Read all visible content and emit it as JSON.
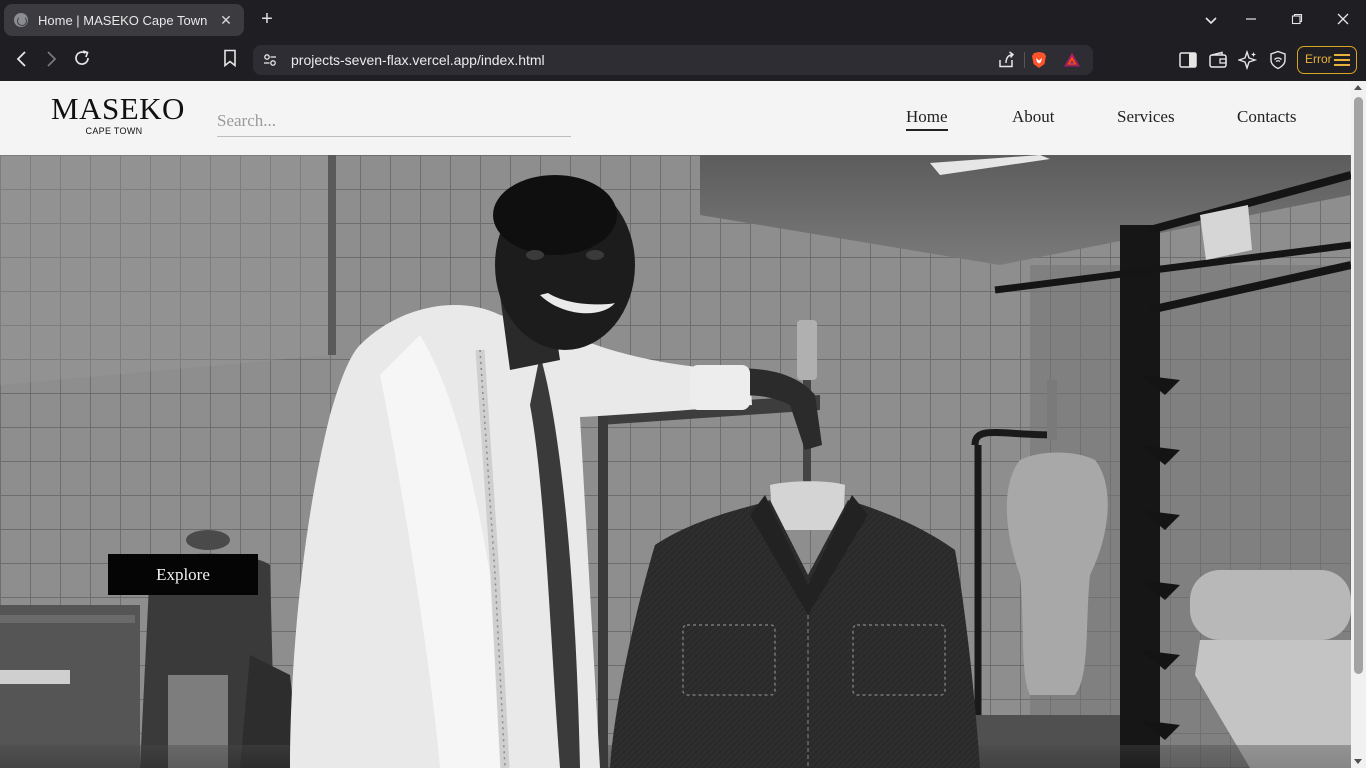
{
  "browser": {
    "tab_title": "Home | MASEKO Cape Town",
    "url": "projects-seven-flax.vercel.app/index.html",
    "error_label": "Error",
    "icons": [
      "globe-icon",
      "close-icon",
      "plus-icon",
      "chevron-down-icon",
      "minimize-icon",
      "restore-icon",
      "back-icon",
      "forward-icon",
      "reload-icon",
      "bookmark-icon",
      "site-settings-icon",
      "share-icon",
      "brave-shields-icon",
      "bat-rewards-icon",
      "sidebar-icon",
      "wallet-icon",
      "leo-ai-icon",
      "vpn-icon",
      "menu-icon"
    ],
    "accent": "#d9a41e"
  },
  "site": {
    "logo_main": "MASEKO",
    "logo_sub": "CAPE TOWN",
    "search_placeholder": "Search...",
    "nav": [
      {
        "label": "Home",
        "active": true
      },
      {
        "label": "About",
        "active": false
      },
      {
        "label": "Services",
        "active": false
      },
      {
        "label": "Contacts",
        "active": false
      }
    ],
    "hero_button": "Explore"
  }
}
